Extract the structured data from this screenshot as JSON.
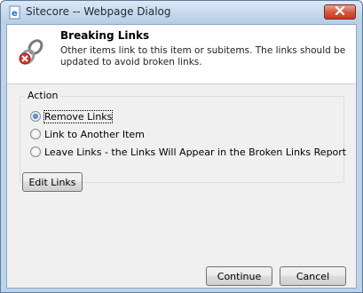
{
  "window": {
    "title": "Sitecore -- Webpage Dialog"
  },
  "header": {
    "title": "Breaking Links",
    "description": "Other items link to this item or subitems. The links should be updated to avoid broken links."
  },
  "action": {
    "legend": "Action",
    "options": [
      {
        "label": "Remove Links",
        "selected": true
      },
      {
        "label": "Link to Another Item",
        "selected": false
      },
      {
        "label": "Leave Links - the Links Will Appear in the Broken Links Report",
        "selected": false
      }
    ]
  },
  "buttons": {
    "edit_links": "Edit Links",
    "continue": "Continue",
    "cancel": "Cancel"
  },
  "icons": {
    "title": "ie-page-icon",
    "header": "broken-link-icon",
    "close": "close-icon"
  },
  "colors": {
    "titlebar": "#c3d7ec",
    "close": "#d65b42",
    "dialog_bg": "#f0f0f0"
  }
}
